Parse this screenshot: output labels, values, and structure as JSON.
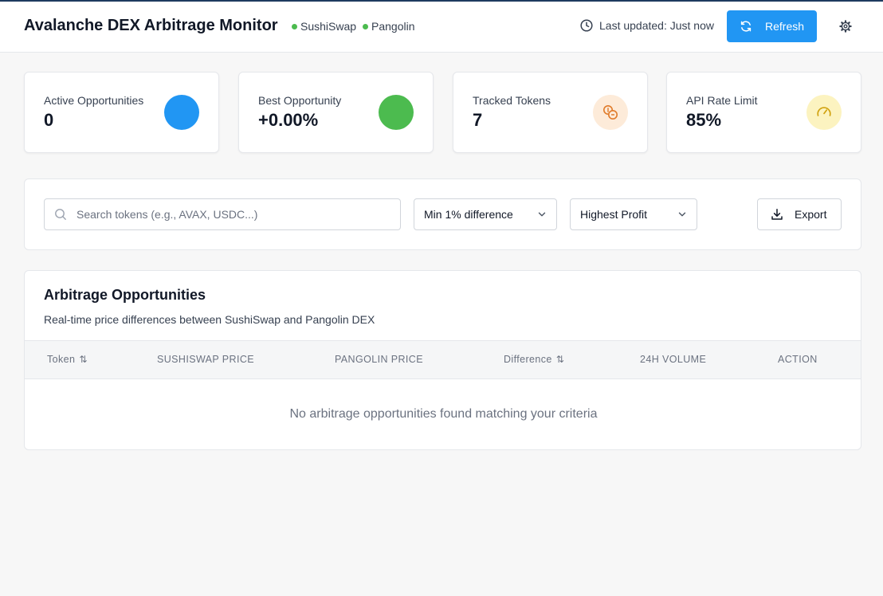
{
  "header": {
    "title": "Avalanche DEX Arbitrage Monitor",
    "dex_status": [
      {
        "label": "SushiSwap",
        "color": "#4cbb4f"
      },
      {
        "label": "Pangolin",
        "color": "#4cbb4f"
      }
    ],
    "last_updated": "Last updated: Just now",
    "refresh_label": "Refresh"
  },
  "stats": [
    {
      "label": "Active Opportunities",
      "value": "0",
      "icon": "circle-blue",
      "icon_color": "#2196f3"
    },
    {
      "label": "Best Opportunity",
      "value": "+0.00%",
      "icon": "circle-green",
      "icon_color": "#4cbb4f"
    },
    {
      "label": "Tracked Tokens",
      "value": "7",
      "icon": "coins-icon",
      "icon_color": "#e07b2a"
    },
    {
      "label": "API Rate Limit",
      "value": "85%",
      "icon": "gauge-icon",
      "icon_color": "#d1a20f"
    }
  ],
  "filters": {
    "search_placeholder": "Search tokens (e.g., AVAX, USDC...)",
    "search_value": "",
    "min_difference": "Min 1% difference",
    "sort_by": "Highest Profit",
    "export_label": "Export"
  },
  "table": {
    "title": "Arbitrage Opportunities",
    "subtitle": "Real-time price differences between SushiSwap and Pangolin DEX",
    "columns": [
      {
        "label": "Token",
        "sortable": true
      },
      {
        "label": "SUSHISWAP PRICE",
        "sortable": false
      },
      {
        "label": "PANGOLIN PRICE",
        "sortable": false
      },
      {
        "label": "Difference",
        "sortable": true
      },
      {
        "label": "24H VOLUME",
        "sortable": false
      },
      {
        "label": "ACTION",
        "sortable": false
      }
    ],
    "sort_glyph": "⇅",
    "rows": [],
    "empty_message": "No arbitrage opportunities found matching your criteria"
  },
  "colors": {
    "accent": "#2196f3",
    "success": "#4cbb4f"
  }
}
